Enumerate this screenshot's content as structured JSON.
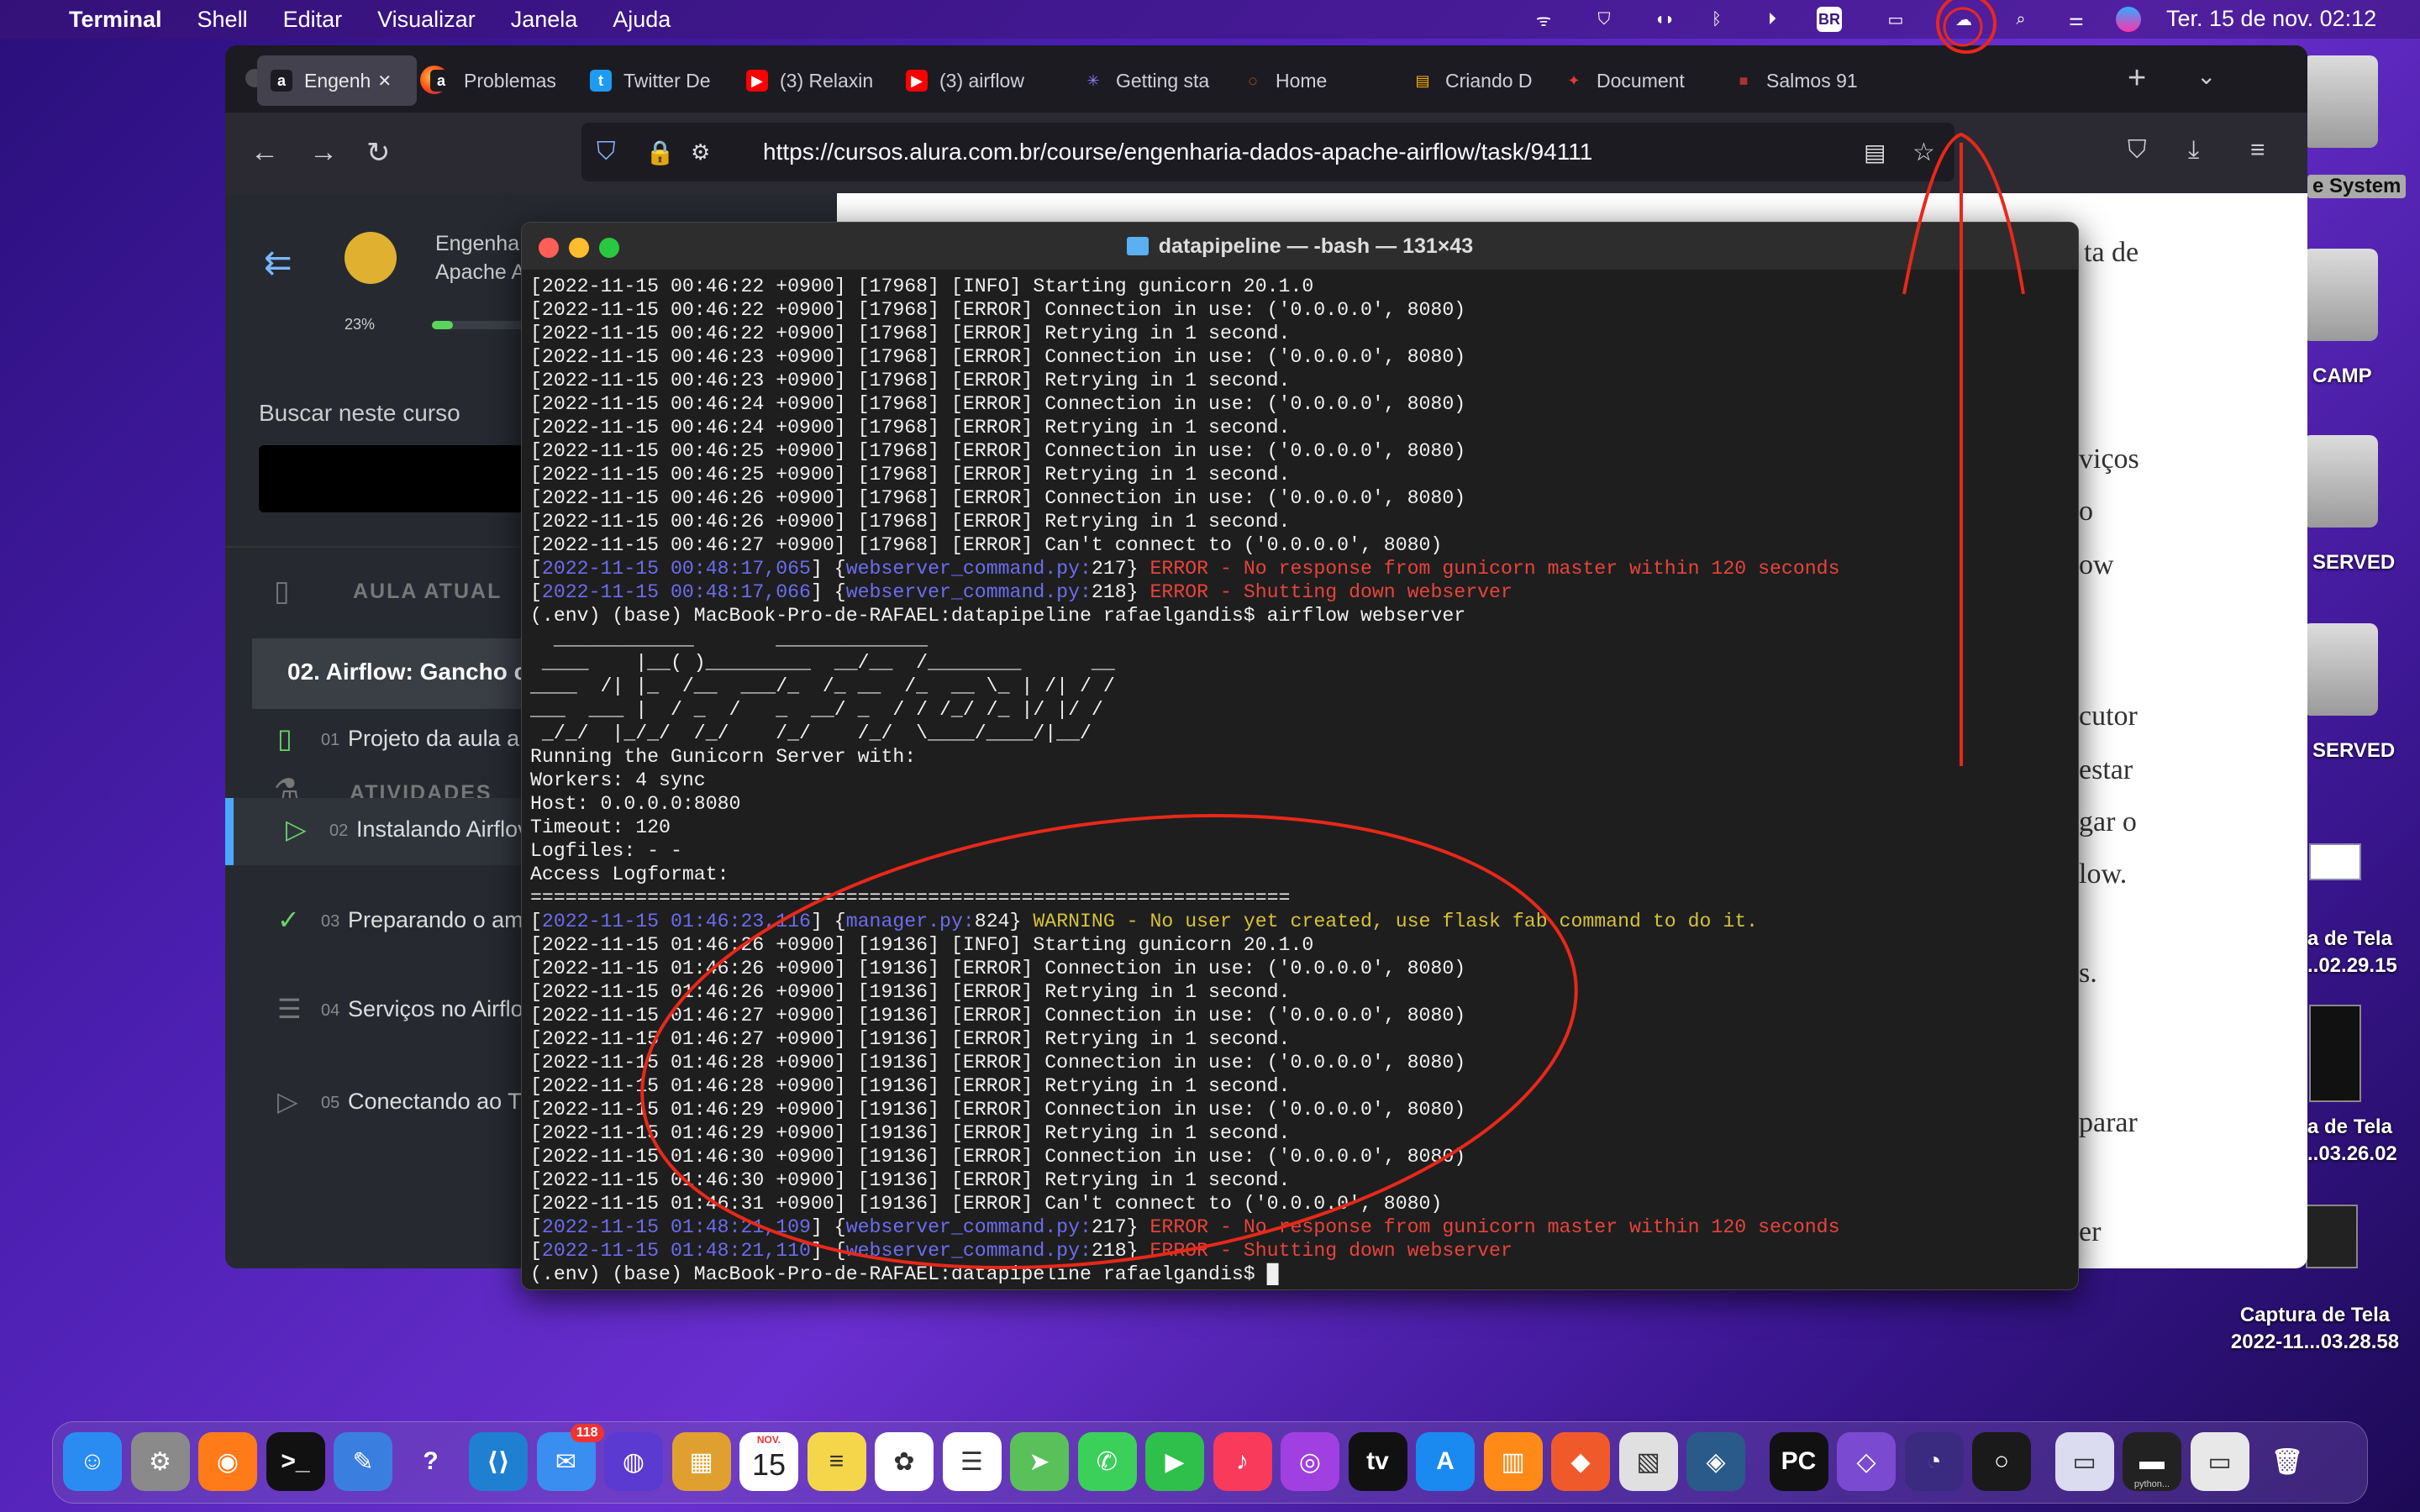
{
  "menubar": {
    "app": "Terminal",
    "items": [
      "Shell",
      "Editar",
      "Visualizar",
      "Janela",
      "Ajuda"
    ],
    "clock": "Ter. 15 de nov.  02:12",
    "keyboard": "BR"
  },
  "browser": {
    "tabs": [
      {
        "label": "Engenh",
        "icon": "a",
        "color": "#ffffff",
        "bg": "#1c1b22"
      },
      {
        "label": "Problemas",
        "icon": "a",
        "color": "#ffffff",
        "bg": "#1c1b22"
      },
      {
        "label": "Twitter De",
        "icon": "t",
        "color": "#ffffff",
        "bg": "#1d9bf0"
      },
      {
        "label": "(3) Relaxin",
        "icon": "▶",
        "color": "#ffffff",
        "bg": "#ff0000"
      },
      {
        "label": "(3) airflow",
        "icon": "▶",
        "color": "#ffffff",
        "bg": "#ff0000"
      },
      {
        "label": "Getting sta",
        "icon": "✳",
        "color": "#8a7cff",
        "bg": "#1c1b22"
      },
      {
        "label": "Home",
        "icon": "◌",
        "color": "#ff7a18",
        "bg": "#1c1b22"
      },
      {
        "label": "Criando D",
        "icon": "▤",
        "color": "#ffb000",
        "bg": "#1c1b22"
      },
      {
        "label": "Document",
        "icon": "✦",
        "color": "#e23a3a",
        "bg": "#1c1b22"
      },
      {
        "label": "Salmos 91",
        "icon": "■",
        "color": "#a33",
        "bg": "#1c1b22"
      }
    ],
    "url": "https://cursos.alura.com.br/course/engenharia-dados-apache-airflow/task/94111"
  },
  "course": {
    "title1": "Engenha",
    "title2": "Apache A",
    "progress": "23%",
    "progress_value": 0.23,
    "search_label": "Buscar neste curso",
    "current_header": "AULA ATUAL",
    "current_lesson": "02. Airflow: Gancho co",
    "activities_header": "ATIVIDADES",
    "activities": [
      {
        "num": "01",
        "label": "Projeto da aula an"
      },
      {
        "num": "02",
        "label": "Instalando Airflov"
      },
      {
        "num": "03",
        "label": "Preparando o am"
      },
      {
        "num": "04",
        "label": "Serviços no Airflo"
      },
      {
        "num": "05",
        "label": "Conectando ao Tv"
      }
    ]
  },
  "page_fragments": [
    "ta de",
    "viços",
    "o",
    "ow",
    "cutor",
    "estar",
    "gar o",
    "low.",
    "s.",
    "parar",
    "er"
  ],
  "terminal": {
    "title": "datapipeline — -bash — 131×43",
    "lines": [
      [
        [
          "[2022-11-15 00:46:22 +0900] [17968] [INFO] Starting gunicorn 20.1.0",
          ""
        ]
      ],
      [
        [
          "[2022-11-15 00:46:22 +0900] [17968] [ERROR] Connection in use: ('0.0.0.0', 8080)",
          ""
        ]
      ],
      [
        [
          "[2022-11-15 00:46:22 +0900] [17968] [ERROR] Retrying in 1 second.",
          ""
        ]
      ],
      [
        [
          "[2022-11-15 00:46:23 +0900] [17968] [ERROR] Connection in use: ('0.0.0.0', 8080)",
          ""
        ]
      ],
      [
        [
          "[2022-11-15 00:46:23 +0900] [17968] [ERROR] Retrying in 1 second.",
          ""
        ]
      ],
      [
        [
          "[2022-11-15 00:46:24 +0900] [17968] [ERROR] Connection in use: ('0.0.0.0', 8080)",
          ""
        ]
      ],
      [
        [
          "[2022-11-15 00:46:24 +0900] [17968] [ERROR] Retrying in 1 second.",
          ""
        ]
      ],
      [
        [
          "[2022-11-15 00:46:25 +0900] [17968] [ERROR] Connection in use: ('0.0.0.0', 8080)",
          ""
        ]
      ],
      [
        [
          "[2022-11-15 00:46:25 +0900] [17968] [ERROR] Retrying in 1 second.",
          ""
        ]
      ],
      [
        [
          "[2022-11-15 00:46:26 +0900] [17968] [ERROR] Connection in use: ('0.0.0.0', 8080)",
          ""
        ]
      ],
      [
        [
          "[2022-11-15 00:46:26 +0900] [17968] [ERROR] Retrying in 1 second.",
          ""
        ]
      ],
      [
        [
          "[2022-11-15 00:46:27 +0900] [17968] [ERROR] Can't connect to ('0.0.0.0', 8080)",
          ""
        ]
      ],
      [
        [
          "[",
          ""
        ],
        [
          "2022-11-15 00:48:17,065",
          "ts"
        ],
        [
          "] {",
          ""
        ],
        [
          "webserver_command.py:",
          "fl"
        ],
        [
          "217} ",
          ""
        ],
        [
          "ERROR - No response from gunicorn master within 120 seconds",
          "er"
        ]
      ],
      [
        [
          "[",
          ""
        ],
        [
          "2022-11-15 00:48:17,066",
          "ts"
        ],
        [
          "] {",
          ""
        ],
        [
          "webserver_command.py:",
          "fl"
        ],
        [
          "218} ",
          ""
        ],
        [
          "ERROR - Shutting down webserver",
          "er"
        ]
      ],
      [
        [
          "(.env) (base) MacBook-Pro-de-RAFAEL:datapipeline rafaelgandis$ airflow webserver",
          ""
        ]
      ],
      [
        [
          "  ____________       _____________",
          ""
        ]
      ],
      [
        [
          " ____    |__( )_________  __/__  /________      __",
          ""
        ]
      ],
      [
        [
          "____  /| |_  /__  ___/_  /_ __  /_  __ \\_ | /| / /",
          ""
        ]
      ],
      [
        [
          "___  ___ |  / _  /   _  __/ _  / / /_/ /_ |/ |/ /",
          ""
        ]
      ],
      [
        [
          " _/_/  |_/_/  /_/    /_/    /_/  \\____/____/|__/",
          ""
        ]
      ],
      [
        [
          "Running the Gunicorn Server with:",
          ""
        ]
      ],
      [
        [
          "Workers: 4 sync",
          ""
        ]
      ],
      [
        [
          "Host: 0.0.0.0:8080",
          ""
        ]
      ],
      [
        [
          "Timeout: 120",
          ""
        ]
      ],
      [
        [
          "Logfiles: - -",
          ""
        ]
      ],
      [
        [
          "Access Logformat:",
          ""
        ]
      ],
      [
        [
          "=================================================================",
          ""
        ]
      ],
      [
        [
          "[",
          ""
        ],
        [
          "2022-11-15 01:46:23,116",
          "ts"
        ],
        [
          "] {",
          ""
        ],
        [
          "manager.py:",
          "fl"
        ],
        [
          "824} ",
          ""
        ],
        [
          "WARNING - No user yet created, use flask fab command to do it.",
          "wn"
        ]
      ],
      [
        [
          "[2022-11-15 01:46:26 +0900] [19136] [INFO] Starting gunicorn 20.1.0",
          ""
        ]
      ],
      [
        [
          "[2022-11-15 01:46:26 +0900] [19136] [ERROR] Connection in use: ('0.0.0.0', 8080)",
          ""
        ]
      ],
      [
        [
          "[2022-11-15 01:46:26 +0900] [19136] [ERROR] Retrying in 1 second.",
          ""
        ]
      ],
      [
        [
          "[2022-11-15 01:46:27 +0900] [19136] [ERROR] Connection in use: ('0.0.0.0', 8080)",
          ""
        ]
      ],
      [
        [
          "[2022-11-15 01:46:27 +0900] [19136] [ERROR] Retrying in 1 second.",
          ""
        ]
      ],
      [
        [
          "[2022-11-15 01:46:28 +0900] [19136] [ERROR] Connection in use: ('0.0.0.0', 8080)",
          ""
        ]
      ],
      [
        [
          "[2022-11-15 01:46:28 +0900] [19136] [ERROR] Retrying in 1 second.",
          ""
        ]
      ],
      [
        [
          "[2022-11-15 01:46:29 +0900] [19136] [ERROR] Connection in use: ('0.0.0.0', 8080)",
          ""
        ]
      ],
      [
        [
          "[2022-11-15 01:46:29 +0900] [19136] [ERROR] Retrying in 1 second.",
          ""
        ]
      ],
      [
        [
          "[2022-11-15 01:46:30 +0900] [19136] [ERROR] Connection in use: ('0.0.0.0', 8080)",
          ""
        ]
      ],
      [
        [
          "[2022-11-15 01:46:30 +0900] [19136] [ERROR] Retrying in 1 second.",
          ""
        ]
      ],
      [
        [
          "[2022-11-15 01:46:31 +0900] [19136] [ERROR] Can't connect to ('0.0.0.0', 8080)",
          ""
        ]
      ],
      [
        [
          "[",
          ""
        ],
        [
          "2022-11-15 01:48:21,109",
          "ts"
        ],
        [
          "] {",
          ""
        ],
        [
          "webserver_command.py:",
          "fl"
        ],
        [
          "217} ",
          ""
        ],
        [
          "ERROR - No response from gunicorn master within 120 seconds",
          "er"
        ]
      ],
      [
        [
          "[",
          ""
        ],
        [
          "2022-11-15 01:48:21,110",
          "ts"
        ],
        [
          "] {",
          ""
        ],
        [
          "webserver_command.py:",
          "fl"
        ],
        [
          "218} ",
          ""
        ],
        [
          "ERROR - Shutting down webserver",
          "er"
        ]
      ],
      [
        [
          "(.env) (base) MacBook-Pro-de-RAFAEL:datapipeline rafaelgandis$ ",
          ""
        ],
        [
          "█",
          ""
        ]
      ]
    ]
  },
  "desktop": {
    "items": [
      "e System",
      "CAMP",
      "SERVED",
      "SERVED",
      "a de Tela",
      "..02.29.15",
      "a de Tela",
      "..03.26.02",
      "Captura de Tela",
      "2022-11...03.28.58"
    ]
  },
  "dock": {
    "mail_badge": "118",
    "calendar_month": "NOV.",
    "calendar_day": "15",
    "apps": [
      {
        "name": "finder",
        "glyph": "☺",
        "bg": "#2a8cf0"
      },
      {
        "name": "system-preferences",
        "glyph": "⚙",
        "bg": "#8a8a8a"
      },
      {
        "name": "firefox",
        "glyph": "◉",
        "bg": "#ff7a18"
      },
      {
        "name": "terminal",
        "glyph": ">_",
        "bg": "#111111"
      },
      {
        "name": "xcode-instruments",
        "glyph": "✎",
        "bg": "#3a7ee0"
      },
      {
        "name": "help",
        "glyph": "?",
        "bg": "transparent"
      },
      {
        "name": "vscode",
        "glyph": "⟨⟩",
        "bg": "#1f7fd0"
      },
      {
        "name": "mail",
        "glyph": "✉",
        "bg": "#3a8ef0"
      },
      {
        "name": "siri",
        "glyph": "◍",
        "bg": "#5a3ad0"
      },
      {
        "name": "launchpad",
        "glyph": "▦",
        "bg": "#e0a030"
      },
      {
        "name": "calendar",
        "glyph": "",
        "bg": "#ffffff"
      },
      {
        "name": "notes",
        "glyph": "≡",
        "bg": "#f5d64a"
      },
      {
        "name": "photos",
        "glyph": "✿",
        "bg": "#ffffff"
      },
      {
        "name": "reminders",
        "glyph": "☰",
        "bg": "#ffffff"
      },
      {
        "name": "maps",
        "glyph": "➤",
        "bg": "#5ac05a"
      },
      {
        "name": "messages",
        "glyph": "✆",
        "bg": "#3ad05a"
      },
      {
        "name": "facetime",
        "glyph": "▶",
        "bg": "#2ec04a"
      },
      {
        "name": "music",
        "glyph": "♪",
        "bg": "#fa3a5a"
      },
      {
        "name": "podcasts",
        "glyph": "◎",
        "bg": "#a040e0"
      },
      {
        "name": "apple-tv",
        "glyph": "tv",
        "bg": "#111111"
      },
      {
        "name": "app-store",
        "glyph": "A",
        "bg": "#1a8af0"
      },
      {
        "name": "books",
        "glyph": "▥",
        "bg": "#ff8a18"
      },
      {
        "name": "swift-playgrounds",
        "glyph": "◆",
        "bg": "#f05a2a"
      },
      {
        "name": "preview",
        "glyph": "▧",
        "bg": "#e0e0e0"
      },
      {
        "name": "mysql-workbench",
        "glyph": "◈",
        "bg": "#2a5a8a"
      },
      {
        "name": "pycharm",
        "glyph": "PC",
        "bg": "#111111"
      },
      {
        "name": "visual-studio",
        "glyph": "◇",
        "bg": "#7a4ad0"
      },
      {
        "name": "podcast-app",
        "glyph": "◔",
        "bg": "#3a2a80"
      },
      {
        "name": "activity",
        "glyph": "○",
        "bg": "#1a1a1a"
      },
      {
        "name": "screenshot-1",
        "glyph": "▭",
        "bg": "#dcdcf0"
      },
      {
        "name": "screenshot-2",
        "glyph": "▬",
        "bg": "#222222"
      },
      {
        "name": "screenshot-3",
        "glyph": "▭",
        "bg": "#e8e8e8"
      },
      {
        "name": "trash",
        "glyph": "🗑",
        "bg": "transparent"
      }
    ],
    "python_label": "python..."
  }
}
